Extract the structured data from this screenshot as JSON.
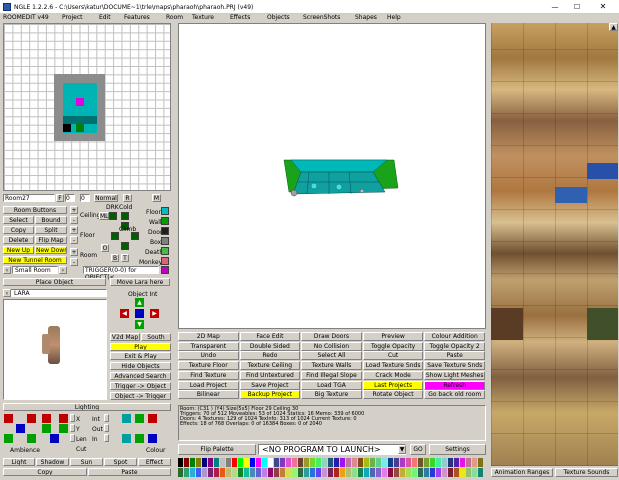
{
  "title": "NGLE 1.2.2.6 - C:\\Users\\katur\\DOCUME~1\\trle\\maps\\pharaoh\\pharaoh.PRJ  (v49)",
  "menu": [
    "ROOMEDIT v49",
    "Project",
    "Edit",
    "Features",
    "Room",
    "Texture",
    "Effects",
    "Objects",
    "ScreenShots",
    "Shapes",
    "Help"
  ],
  "room_panel": {
    "room_name": "Room27",
    "field1": "0",
    "field2": "0",
    "normal": "Normal",
    "r": "R",
    "m": "M",
    "room_buttons": "Room Buttons",
    "select": "Select",
    "bound": "Bound",
    "copy": "Copy",
    "split": "Split",
    "delete": "Delete",
    "flip_map": "Flip Map",
    "new_up": "New Up",
    "new_down": "New Down",
    "new_tunnel": "New Tunnel Room",
    "small_room": "Small Room",
    "ceiling": "Ceiling",
    "floor": "Floor",
    "room": "Room",
    "drk": "DRK",
    "cold": "Cold",
    "ml": "ML",
    "climb": "Climb",
    "o": "O",
    "b": "B",
    "t": "T",
    "floor_lbl": "Floor",
    "wall": "Wall",
    "door": "Door",
    "box": "Box",
    "death": "Death",
    "monkey": "Monkey",
    "trigger": "TRIGGER(0-0) for OBJECT(<"
  },
  "place_object": "Place Object",
  "move_lara": "Move Lara here",
  "object_name": "LARA",
  "object_int": "Object Int",
  "mid_buttons": {
    "map2d": "V2d Map",
    "south": "South",
    "play": "Play",
    "exit_play": "Exit & Play",
    "hide_objects": "Hide Objects",
    "advanced_search": "Advanced Search",
    "trigger_obj": "Trigger -> Object",
    "obj_trigger": "Object -> Trigger"
  },
  "lighting": {
    "title": "Lighting",
    "x": "X",
    "y": "Y",
    "len": "Len",
    "cut": "Cut",
    "int": "Int",
    "out": "Out",
    "in": "In",
    "ambience": "Ambience",
    "colour": "Colour",
    "light": "Light",
    "shadow": "Shadow",
    "sun": "Sun",
    "spot": "Spot",
    "effect": "Effect",
    "copy": "Copy",
    "paste": "Paste"
  },
  "grid_buttons": [
    [
      "2D Map",
      "Face Edit",
      "Draw Doors",
      "Preview",
      "Colour Addition"
    ],
    [
      "Transparent",
      "Double Sided",
      "No Collision",
      "Toggle Opacity",
      "Toggle Opacity 2"
    ],
    [
      "Undo",
      "Redo",
      "Select All",
      "Cut",
      "Paste"
    ],
    [
      "Texture Floor",
      "Texture Ceiling",
      "Texture Walls",
      "Load Texture Snds",
      "Save Texture Snds"
    ],
    [
      "Find Texture",
      "Find Untextured",
      "Find Illegal Slope",
      "Crack Mode",
      "Show Light Meshes"
    ],
    [
      "Load Project",
      "Save Project",
      "Load TGA",
      "Last Projects",
      "Refresh"
    ],
    [
      "Bilinear",
      "Backup Project",
      "Big Texture",
      "Rotate Object",
      "Go back old room"
    ]
  ],
  "status": {
    "line1": "Room: (C31  ) (Y4)       Size(5x5)      Floor 29 Ceiling 30",
    "line2": "Triggers: 70 of 512   Moveables: 53 of 1024   Statics: 16     Memo: 339 of 6000",
    "line3": "Doors: 4    Textures: 129 of 1024   TexInfo: 313 of 1024     Current Texture: 0",
    "line4": "Effects: 18 of 768 Overlaps: 0 of 16384   Boxes: 0 of 2040"
  },
  "flip_palette": "Flip Palette",
  "launch": "<NO PROGRAM TO LAUNCH>",
  "go": "GO",
  "settings": "Settings",
  "animation_ranges": "Animation Ranges",
  "texture_sounds": "Texture Sounds"
}
